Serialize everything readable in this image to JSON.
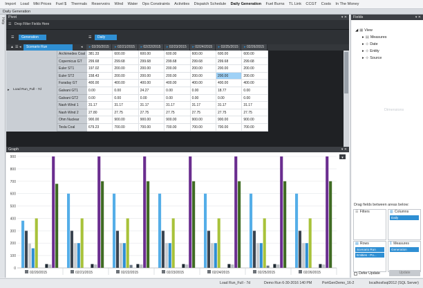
{
  "menu": [
    "Import",
    "Load",
    "Mkt Prices",
    "Fuel $",
    "Thermals",
    "Reservoirs",
    "Wind",
    "Water",
    "Ops Constraints",
    "Activities",
    "Dispatch Schedule",
    "Daily Generation",
    "Fuel Burns",
    "TL Link",
    "CCGT",
    "Costs",
    "In The Money"
  ],
  "menu_active": "Daily Generation",
  "window_title": "Daily Generation",
  "side_tab": "Help",
  "pivot": {
    "title": "Pivot",
    "filter_hint": "Drop Filter Fields Here",
    "data_field": "Generation",
    "column_field": "Daily",
    "row_field": "Scenario Run",
    "row_group_label": "Load Run_Full  - 7d",
    "dates": [
      "02/20/2015",
      "02/21/2015",
      "02/22/2015",
      "02/23/2015",
      "02/24/2015",
      "02/25/2015",
      "02/26/2015"
    ],
    "rows": [
      {
        "name": "Archimedes Coal",
        "values": [
          "381.33",
          "600.00",
          "600.00",
          "600.00",
          "600.00",
          "600.00",
          "600.00"
        ]
      },
      {
        "name": "Copernicus GT",
        "values": [
          "299.68",
          "299.68",
          "299.68",
          "299.68",
          "299.68",
          "299.68",
          "299.68"
        ]
      },
      {
        "name": "Euler ST1",
        "values": [
          "197.02",
          "200.00",
          "200.00",
          "200.00",
          "200.00",
          "200.00",
          "200.00"
        ]
      },
      {
        "name": "Euler ST2",
        "values": [
          "158.43",
          "200.00",
          "200.00",
          "200.00",
          "200.00",
          "200.00",
          "200.00"
        ]
      },
      {
        "name": "Faraday GT",
        "values": [
          "400.00",
          "400.00",
          "400.00",
          "400.00",
          "400.00",
          "400.00",
          "400.00"
        ]
      },
      {
        "name": "Galvani GT1",
        "values": [
          "0.00",
          "0.00",
          "24.27",
          "0.00",
          "0.00",
          "18.77",
          "0.00"
        ]
      },
      {
        "name": "Galvani GT2",
        "values": [
          "0.00",
          "0.00",
          "0.00",
          "0.00",
          "0.00",
          "0.00",
          "0.00"
        ]
      },
      {
        "name": "Nash Wind 1",
        "values": [
          "31.17",
          "31.17",
          "31.17",
          "31.17",
          "31.17",
          "31.17",
          "31.17"
        ]
      },
      {
        "name": "Nash Wind 2",
        "values": [
          "27.80",
          "27.75",
          "27.75",
          "27.75",
          "27.75",
          "27.75",
          "27.75"
        ]
      },
      {
        "name": "Ohm Nuclear",
        "values": [
          "900.00",
          "900.00",
          "900.00",
          "900.00",
          "900.00",
          "900.00",
          "900.00"
        ]
      },
      {
        "name": "Tesla Coal",
        "values": [
          "679.23",
          "700.00",
          "700.00",
          "700.00",
          "700.00",
          "700.00",
          "700.00"
        ]
      }
    ],
    "selected_cell": "02/25/2015|Euler ST2"
  },
  "fields": {
    "title": "Fields",
    "tree": [
      "View",
      "Measures",
      "Date",
      "Entity",
      "Source"
    ],
    "dimensions_label": "Dimensions",
    "drag_hint": "Drag fields between areas below:",
    "filters_label": "Filters",
    "columns_label": "Columns",
    "columns_chips": [
      "Daily"
    ],
    "rows_label": "Rows",
    "rows_chips": [
      "Scenario Run",
      "Entities - Po..."
    ],
    "measures_label": "Measures",
    "measures_chips": [
      "Generation"
    ],
    "defer_label": "Defer Update",
    "update_label": "Update"
  },
  "graph": {
    "title": "Graph"
  },
  "chart_data": {
    "type": "bar",
    "categories": [
      "02/20/2015",
      "02/21/2015",
      "02/22/2015",
      "02/23/2015",
      "02/24/2015",
      "02/25/2015",
      "02/26/2015"
    ],
    "ylim": [
      0,
      900
    ],
    "yticks": [
      0,
      100,
      200,
      300,
      400,
      500,
      600,
      700,
      800,
      900
    ],
    "series": [
      {
        "color": "#55aee8",
        "values": [
          381.33,
          600,
          600,
          600,
          600,
          600,
          600
        ]
      },
      {
        "color": "#3a4450",
        "values": [
          299.68,
          299.68,
          299.68,
          299.68,
          299.68,
          299.68,
          299.68
        ]
      },
      {
        "color": "#c9ccd0",
        "values": [
          197.02,
          200,
          200,
          200,
          200,
          200,
          200
        ]
      },
      {
        "color": "#2f8fd3",
        "values": [
          158.43,
          200,
          200,
          200,
          200,
          200,
          200
        ]
      },
      {
        "color": "#a8c23a",
        "values": [
          400,
          400,
          400,
          400,
          400,
          400,
          400
        ]
      },
      {
        "color": "#6d7a86",
        "values": [
          0,
          0,
          24.27,
          0,
          0,
          18.77,
          0
        ]
      },
      {
        "color": "#1d2b36",
        "values": [
          0,
          0,
          0,
          0,
          0,
          0,
          0
        ]
      },
      {
        "color": "#1f2a33",
        "values": [
          31.17,
          31.17,
          31.17,
          31.17,
          31.17,
          31.17,
          31.17
        ]
      },
      {
        "color": "#b9bec4",
        "values": [
          27.8,
          27.75,
          27.75,
          27.75,
          27.75,
          27.75,
          27.75
        ]
      },
      {
        "color": "#6a2d8f",
        "values": [
          900,
          900,
          900,
          900,
          900,
          900,
          900
        ]
      },
      {
        "color": "#3f6b23",
        "values": [
          679.23,
          700,
          700,
          700,
          700,
          700,
          700
        ]
      }
    ]
  },
  "status": {
    "run": "Load Run_Full - 7d",
    "demo": "Demo Run 6-30-2016 140 PM",
    "portal": "PortGenDemo_16-2",
    "server": "localhost\\sql2012 (SQL Server)"
  }
}
